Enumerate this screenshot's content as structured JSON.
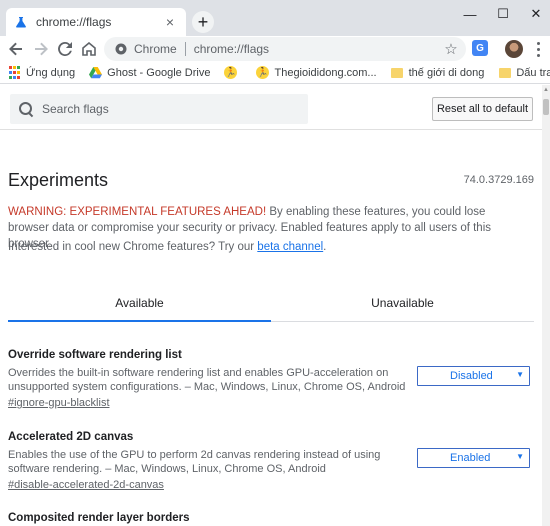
{
  "browser": {
    "tab_title": "chrome://flags",
    "new_tab_label": "+",
    "omnibox_scheme_label": "Chrome",
    "omnibox_url": "chrome://flags",
    "window_controls": {
      "minimize": "—",
      "maximize": "☐",
      "close": "✕"
    },
    "profile_badge": "G"
  },
  "bookmarks": [
    {
      "label": "Ứng dụng",
      "icon": "apps-grid-icon"
    },
    {
      "label": "Ghost - Google Drive",
      "icon": "google-drive-icon"
    },
    {
      "label": "",
      "icon": "running-man-icon"
    },
    {
      "label": "Thegioididong.com...",
      "icon": "running-man-icon"
    },
    {
      "label": "thế giới di dong",
      "icon": "folder-icon"
    },
    {
      "label": "Dấu trang khác",
      "icon": "folder-icon"
    }
  ],
  "flags_page": {
    "search_placeholder": "Search flags",
    "reset_button": "Reset all to default",
    "title": "Experiments",
    "version": "74.0.3729.169",
    "warning_prefix": "WARNING: EXPERIMENTAL FEATURES AHEAD!",
    "warning_body": " By enabling these features, you could lose browser data or compromise your security or privacy. Enabled features apply to all users of this browser.",
    "cool_text": "Interested in cool new Chrome features? Try our ",
    "cool_link": "beta channel",
    "cool_suffix": ".",
    "tabs": {
      "available": "Available",
      "unavailable": "Unavailable"
    },
    "experiments": [
      {
        "name": "Override software rendering list",
        "description": "Overrides the built-in software rendering list and enables GPU-acceleration on unsupported system configurations. – Mac, Windows, Linux, Chrome OS, Android",
        "link": "#ignore-gpu-blacklist",
        "state": "Disabled"
      },
      {
        "name": "Accelerated 2D canvas",
        "description": "Enables the use of the GPU to perform 2d canvas rendering instead of using software rendering. – Mac, Windows, Linux, Chrome OS, Android",
        "link": "#disable-accelerated-2d-canvas",
        "state": "Enabled"
      },
      {
        "name": "Composited render layer borders",
        "description": "",
        "link": "",
        "state": ""
      }
    ]
  },
  "colors": {
    "accent": "#1a73e8",
    "warning_red": "#c53929",
    "tabstrip": "#dee1e6"
  }
}
